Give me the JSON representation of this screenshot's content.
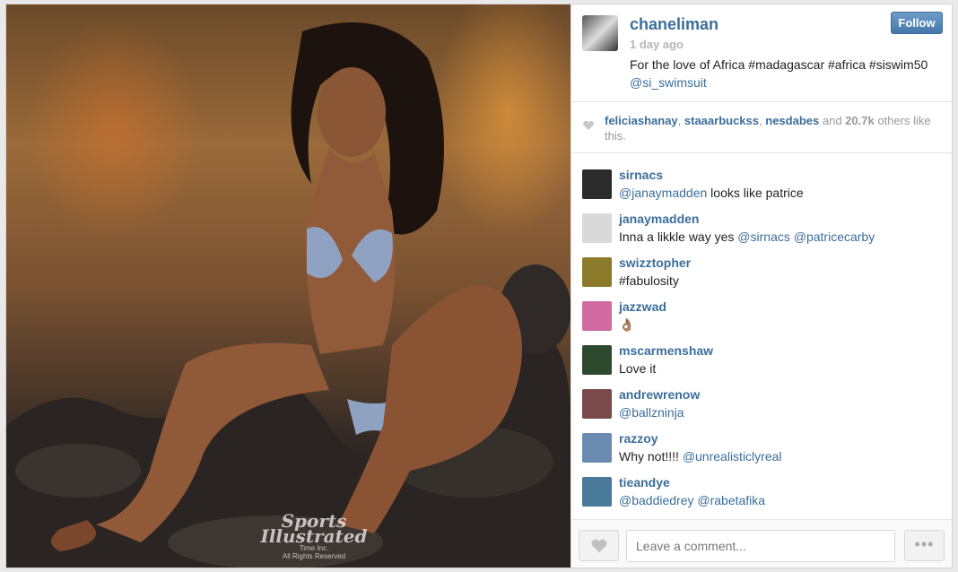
{
  "post": {
    "username": "chaneliman",
    "time": "1 day ago",
    "caption": "For the love of Africa #madagascar #africa #siswim50",
    "caption_mention": "@si_swimsuit",
    "follow_label": "Follow"
  },
  "watermark": {
    "brand_line1": "Sports",
    "brand_line2": "Illustrated",
    "small_line1": "Time Inc.",
    "small_line2": "All Rights Reserved"
  },
  "likes": {
    "users": [
      "feliciashanay",
      "staaarbuckss",
      "nesdabes"
    ],
    "and_text": "and",
    "count": "20.7k",
    "suffix": "others like this."
  },
  "comments": [
    {
      "user": "sirnacs",
      "text": "",
      "mention": "@janaymadden",
      "after": " looks like patrice",
      "avatar_icon": "avatar-sirnacs",
      "avatar_color": "#2b2b2b"
    },
    {
      "user": "janaymadden",
      "text": "Inna a likkle way yes ",
      "mention": "@sirnacs @patricecarby",
      "after": "",
      "avatar_icon": "avatar-janaymadden",
      "avatar_color": "#d9d9d9"
    },
    {
      "user": "swizztopher",
      "text": "#fabulosity",
      "mention": "",
      "after": "",
      "avatar_icon": "avatar-swizztopher",
      "avatar_color": "#8a7a2a"
    },
    {
      "user": "jazzwad",
      "text": "👌🏽",
      "mention": "",
      "after": "",
      "avatar_icon": "avatar-jazzwad",
      "avatar_color": "#d26aa0"
    },
    {
      "user": "mscarmenshaw",
      "text": "Love it",
      "mention": "",
      "after": "",
      "avatar_icon": "avatar-mscarmenshaw",
      "avatar_color": "#2e4a2e"
    },
    {
      "user": "andrewrenow",
      "text": "",
      "mention": "@ballzninja",
      "after": "",
      "avatar_icon": "avatar-andrewrenow",
      "avatar_color": "#7a4a4a"
    },
    {
      "user": "razzoy",
      "text": "Why not!!!! ",
      "mention": "@unrealisticlyreal",
      "after": "",
      "avatar_icon": "avatar-razzoy",
      "avatar_color": "#6a8ab0"
    },
    {
      "user": "tieandye",
      "text": "",
      "mention": "@baddiedrey @rabetafika",
      "after": "",
      "avatar_icon": "avatar-tieandye",
      "avatar_color": "#4a7a9a"
    }
  ],
  "comment_box": {
    "placeholder": "Leave a comment...",
    "more_label": "•••"
  },
  "colors": {
    "link": "#3b6e9a",
    "follow_button": "#4478aa"
  }
}
